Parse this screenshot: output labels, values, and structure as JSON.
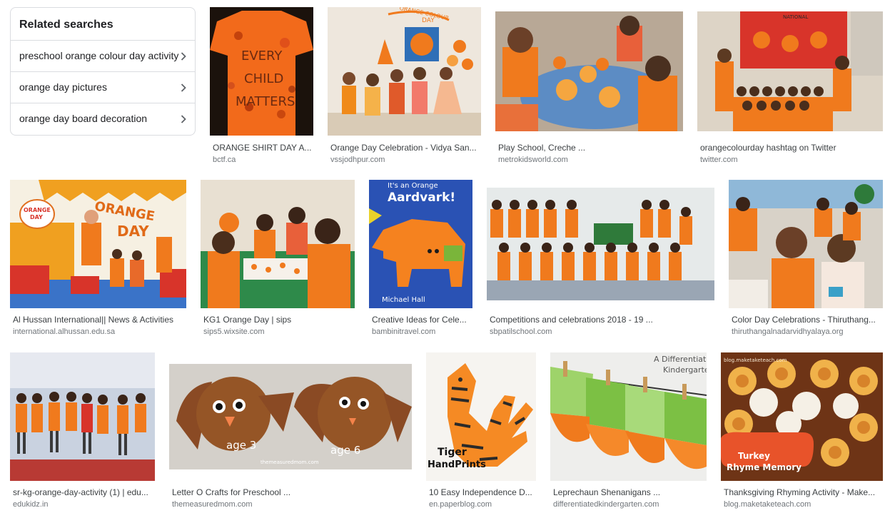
{
  "related": {
    "title": "Related searches",
    "items": [
      {
        "label": "preschool orange colour day activity"
      },
      {
        "label": "orange day pictures"
      },
      {
        "label": "orange day board decoration"
      }
    ]
  },
  "images": [
    {
      "caption": "ORANGE SHIRT DAY A...",
      "source": "bctf.ca",
      "overlay": [
        "EVERY",
        "CHILD",
        "MATTERS"
      ]
    },
    {
      "caption": "Orange Day Celebration - Vidya San...",
      "source": "vssjodhpur.com",
      "overlay": [
        "ORANGE COLOUR",
        "DAY"
      ]
    },
    {
      "caption": "Play School, Creche ...",
      "source": "metrokidsworld.com"
    },
    {
      "caption": "orangecolourday hashtag on Twitter",
      "source": "twitter.com",
      "overlay": [
        "NATIONAL"
      ]
    },
    {
      "caption": "Al Hussan International|| News & Activities",
      "source": "international.alhussan.edu.sa",
      "overlay": [
        "ORANGE",
        "DAY",
        "ORANGE",
        "DAY"
      ]
    },
    {
      "caption": "KG1 Orange Day | sips",
      "source": "sips5.wixsite.com"
    },
    {
      "caption": "Creative Ideas for Cele...",
      "source": "bambinitravel.com",
      "overlay": [
        "It's an Orange",
        "Aardvark!",
        "Michael Hall"
      ]
    },
    {
      "caption": "Competitions and celebrations 2018 - 19 ...",
      "source": "sbpatilschool.com"
    },
    {
      "caption": "Color Day Celebrations - Thiruthang...",
      "source": "thiruthangalnadarvidhyalaya.org"
    },
    {
      "caption": "sr-kg-orange-day-activity (1) | edu...",
      "source": "edukidz.in"
    },
    {
      "caption": "Letter O Crafts for Preschool ...",
      "source": "themeasuredmom.com",
      "overlay": [
        "age 3",
        "age 6",
        "themeasuredmom.com"
      ]
    },
    {
      "caption": "10 Easy Independence D...",
      "source": "en.paperblog.com",
      "overlay": [
        "Tiger",
        "HandPrints"
      ]
    },
    {
      "caption": "Leprechaun Shenanigans ...",
      "source": "differentiatedkindergarten.com",
      "overlay": [
        "A Differentiated",
        "Kindergarten"
      ]
    },
    {
      "caption": "Thanksgiving Rhyming Activity - Make...",
      "source": "blog.maketaketeach.com",
      "overlay": [
        "blog.maketaketeach.com",
        "Turkey",
        "Rhyme Memory"
      ]
    }
  ]
}
